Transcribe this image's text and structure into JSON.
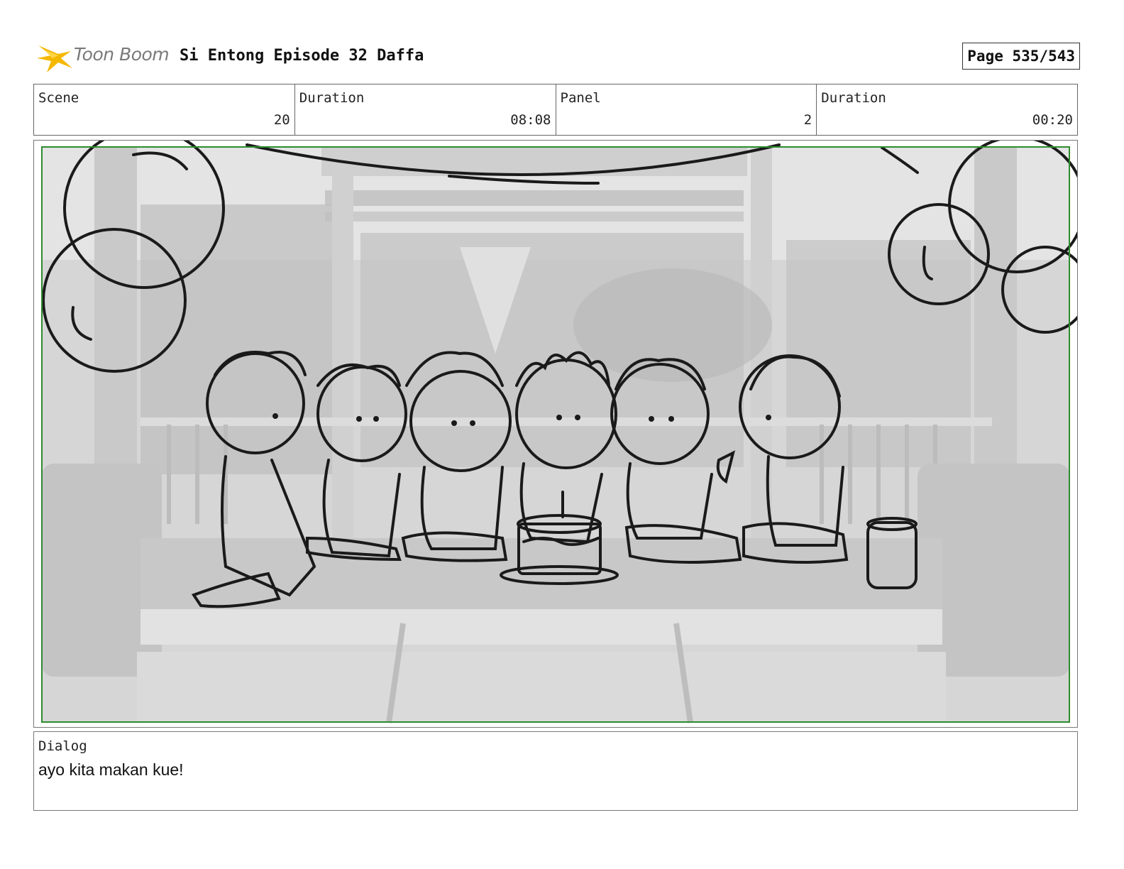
{
  "header": {
    "logo_text": "Toon Boom",
    "title": "Si Entong Episode 32 Daffa",
    "page": "Page 535/543"
  },
  "info": {
    "scene_label": "Scene",
    "scene_value": "20",
    "scene_duration_label": "Duration",
    "scene_duration_value": "08:08",
    "panel_label": "Panel",
    "panel_value": "2",
    "panel_duration_label": "Duration",
    "panel_duration_value": "00:20"
  },
  "dialog": {
    "label": "Dialog",
    "text": "ayo kita makan kue!"
  },
  "colors": {
    "safe_frame": "#2e8b2e",
    "logo_star": "#f5b800",
    "background_gray": "#d4d4d4",
    "sketch_line": "#1a1a1a"
  }
}
